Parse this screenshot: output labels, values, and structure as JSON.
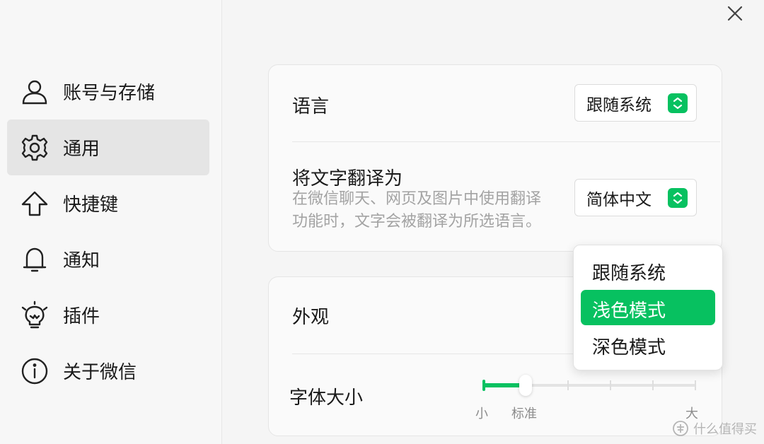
{
  "sidebar": {
    "items": [
      {
        "label": "账号与存储",
        "icon": "user-icon"
      },
      {
        "label": "通用",
        "icon": "gear-icon",
        "active": true
      },
      {
        "label": "快捷键",
        "icon": "up-arrow-icon"
      },
      {
        "label": "通知",
        "icon": "bell-icon"
      },
      {
        "label": "插件",
        "icon": "bulb-icon"
      },
      {
        "label": "关于微信",
        "icon": "info-icon"
      }
    ]
  },
  "settings": {
    "language": {
      "label": "语言",
      "value": "跟随系统"
    },
    "translate": {
      "label": "将文字翻译为",
      "desc_line1": "在微信聊天、网页及图片中使用翻译",
      "desc_line2": "功能时，文字会被翻译为所选语言。",
      "value": "简体中文"
    },
    "appearance": {
      "label": "外观"
    },
    "font_size": {
      "label": "字体大小",
      "min_label": "小",
      "current_label": "标准",
      "max_label": "大",
      "steps": 6,
      "current_step": 1
    }
  },
  "appearance_dropdown": {
    "options": [
      "跟随系统",
      "浅色模式",
      "深色模式"
    ],
    "selected": "浅色模式"
  },
  "watermark": {
    "text": "什么值得买"
  },
  "colors": {
    "accent": "#07c160",
    "active_bg": "#e5e5e5"
  }
}
